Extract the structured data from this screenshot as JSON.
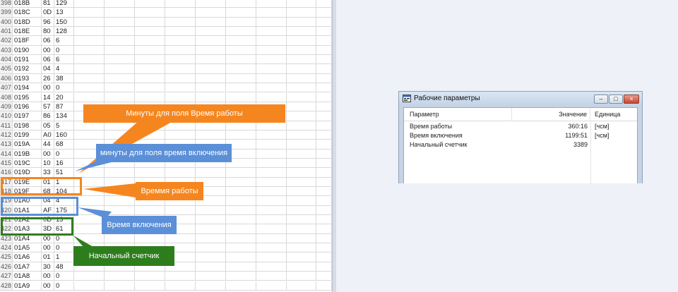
{
  "spreadsheet": {
    "rows": [
      {
        "n": "398",
        "addr": "018B",
        "hex": "81",
        "dec": "129"
      },
      {
        "n": "399",
        "addr": "018C",
        "hex": "0D",
        "dec": "13"
      },
      {
        "n": "400",
        "addr": "018D",
        "hex": "96",
        "dec": "150"
      },
      {
        "n": "401",
        "addr": "018E",
        "hex": "80",
        "dec": "128"
      },
      {
        "n": "402",
        "addr": "018F",
        "hex": "06",
        "dec": "6"
      },
      {
        "n": "403",
        "addr": "0190",
        "hex": "00",
        "dec": "0"
      },
      {
        "n": "404",
        "addr": "0191",
        "hex": "06",
        "dec": "6"
      },
      {
        "n": "405",
        "addr": "0192",
        "hex": "04",
        "dec": "4"
      },
      {
        "n": "406",
        "addr": "0193",
        "hex": "26",
        "dec": "38"
      },
      {
        "n": "407",
        "addr": "0194",
        "hex": "00",
        "dec": "0"
      },
      {
        "n": "408",
        "addr": "0195",
        "hex": "14",
        "dec": "20"
      },
      {
        "n": "409",
        "addr": "0196",
        "hex": "57",
        "dec": "87"
      },
      {
        "n": "410",
        "addr": "0197",
        "hex": "86",
        "dec": "134"
      },
      {
        "n": "411",
        "addr": "0198",
        "hex": "05",
        "dec": "5"
      },
      {
        "n": "412",
        "addr": "0199",
        "hex": "A0",
        "dec": "160"
      },
      {
        "n": "413",
        "addr": "019A",
        "hex": "44",
        "dec": "68"
      },
      {
        "n": "414",
        "addr": "019B",
        "hex": "00",
        "dec": "0"
      },
      {
        "n": "415",
        "addr": "019C",
        "hex": "10",
        "dec": "16"
      },
      {
        "n": "416",
        "addr": "019D",
        "hex": "33",
        "dec": "51"
      },
      {
        "n": "417",
        "addr": "019E",
        "hex": "01",
        "dec": "1"
      },
      {
        "n": "418",
        "addr": "019F",
        "hex": "68",
        "dec": "104"
      },
      {
        "n": "419",
        "addr": "01A0",
        "hex": "04",
        "dec": "4"
      },
      {
        "n": "420",
        "addr": "01A1",
        "hex": "AF",
        "dec": "175"
      },
      {
        "n": "421",
        "addr": "01A2",
        "hex": "0D",
        "dec": "13"
      },
      {
        "n": "422",
        "addr": "01A3",
        "hex": "3D",
        "dec": "61"
      },
      {
        "n": "423",
        "addr": "01A4",
        "hex": "00",
        "dec": "0"
      },
      {
        "n": "424",
        "addr": "01A5",
        "hex": "00",
        "dec": "0"
      },
      {
        "n": "425",
        "addr": "01A6",
        "hex": "01",
        "dec": "1"
      },
      {
        "n": "426",
        "addr": "01A7",
        "hex": "30",
        "dec": "48"
      },
      {
        "n": "427",
        "addr": "01A8",
        "hex": "00",
        "dec": "0"
      },
      {
        "n": "428",
        "addr": "01A9",
        "hex": "00",
        "dec": "0"
      }
    ]
  },
  "callouts": {
    "minutes_work": "Минуты для поля Время работы",
    "minutes_on": "минуты для поля время включения",
    "work_time": "Времмя работы",
    "on_time": "Время включения",
    "start_counter": "Начальный счетчик"
  },
  "colors": {
    "orange": "#f5861f",
    "blue": "#5b8fd8",
    "green": "#2e7d1d"
  },
  "dialog": {
    "title": "Рабочие параметры",
    "icon": "window-app-icon",
    "buttons": {
      "minimize": "–",
      "maximize": "□",
      "close": "×"
    },
    "columns": {
      "param": "Параметр",
      "value": "Значение",
      "unit": "Единица"
    },
    "rows": [
      {
        "param": "Время работы",
        "value": "360:16",
        "unit": "[чсм]"
      },
      {
        "param": "Время включения",
        "value": "1199:51",
        "unit": "[чсм]"
      },
      {
        "param": "Начальный счетчик",
        "value": "3389",
        "unit": ""
      }
    ]
  }
}
